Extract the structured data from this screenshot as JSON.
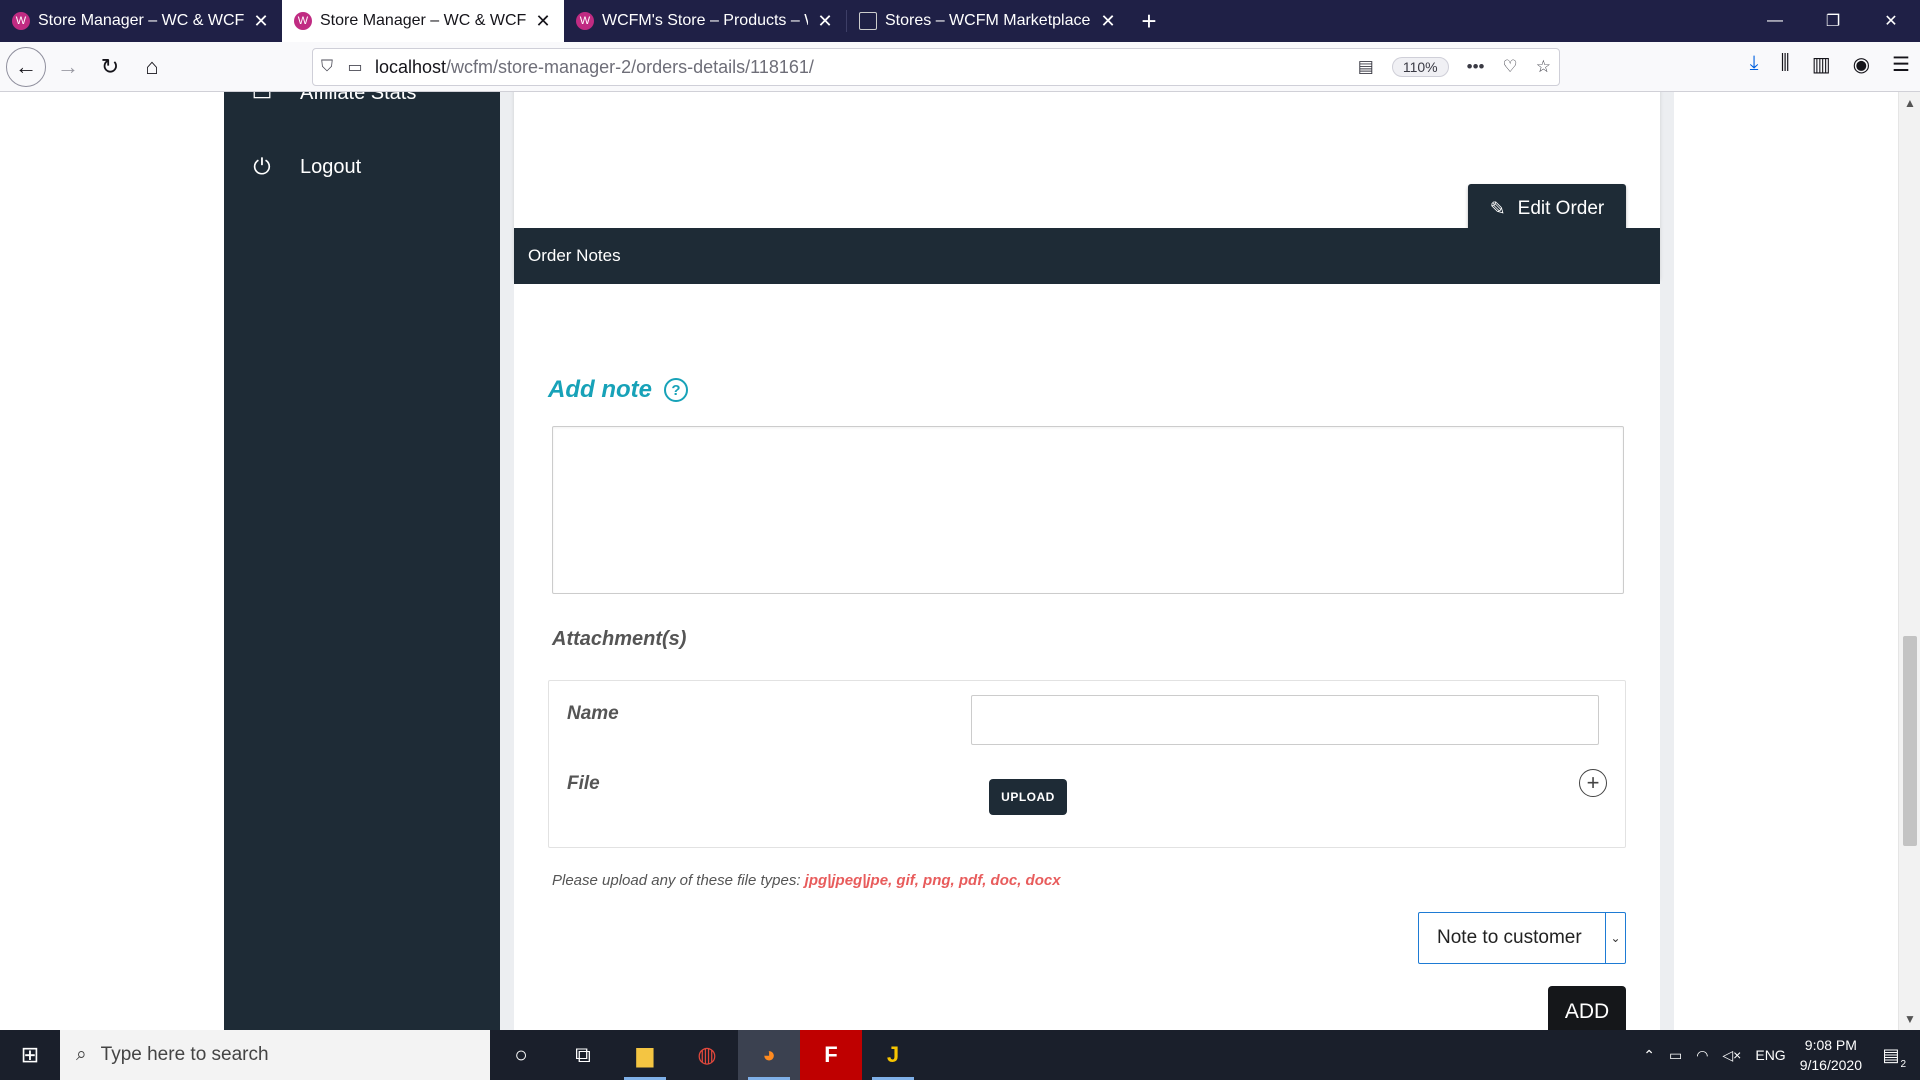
{
  "browser": {
    "tabs": [
      {
        "title": "Store Manager – WC & WCFM",
        "active": false
      },
      {
        "title": "Store Manager – WC & WCFM",
        "active": true
      },
      {
        "title": "WCFM's Store – Products – WC",
        "active": false
      },
      {
        "title": "Stores – WCFM Marketplace",
        "active": false
      }
    ],
    "url_host": "localhost",
    "url_path": "/wcfm/store-manager-2/orders-details/118161/",
    "zoom": "110%"
  },
  "sidebar": {
    "partial_item": "Affiliate Stats",
    "logout_label": "Logout"
  },
  "order": {
    "edit_label": "Edit Order"
  },
  "notes": {
    "header": "Order Notes",
    "add_note_label": "Add note",
    "note_text": "",
    "attachments_label": "Attachment(s)",
    "name_label": "Name",
    "name_value": "",
    "file_label": "File",
    "upload_label": "UPLOAD",
    "file_types_prefix": "Please upload any of these file types: ",
    "file_types": "jpg|jpeg|jpe, gif, png, pdf, doc, docx",
    "note_type": "Note to customer",
    "add_label": "ADD"
  },
  "taskbar": {
    "search_placeholder": "Type here to search",
    "language": "ENG",
    "time": "9:08 PM",
    "date": "9/16/2020",
    "notification_count": "2"
  }
}
